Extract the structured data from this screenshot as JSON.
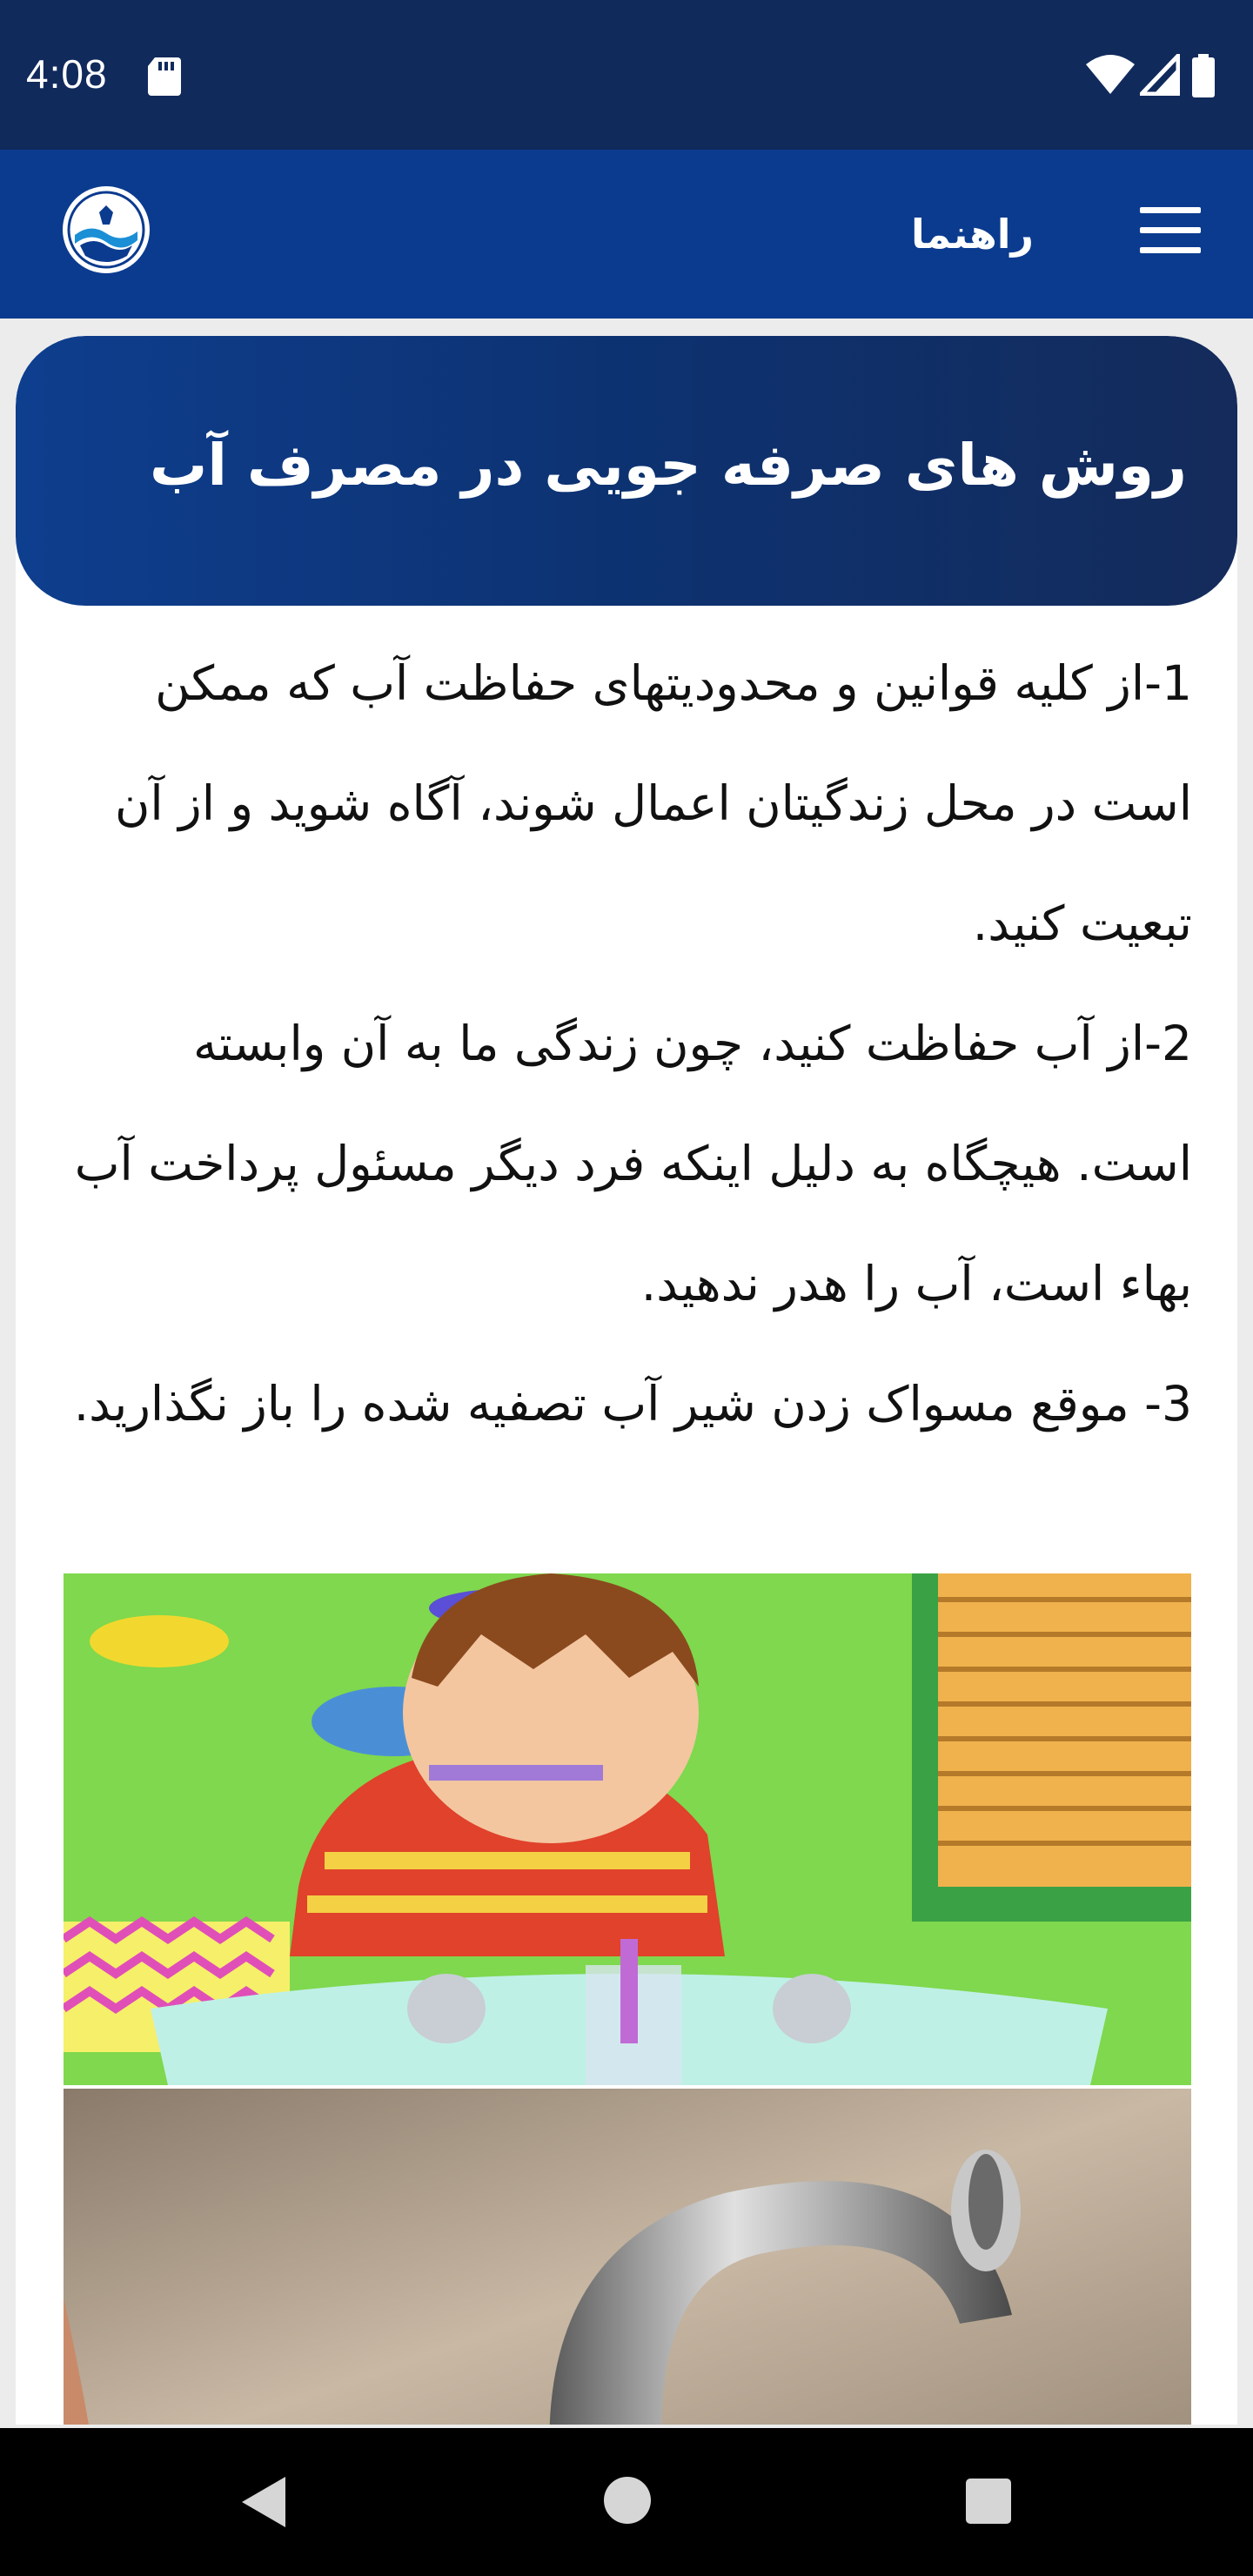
{
  "status_bar": {
    "time": "4:08"
  },
  "app_bar": {
    "title": "راهنما"
  },
  "article": {
    "title": "روش های صرفه جویی در مصرف آب",
    "paragraphs": [
      "1-از کلیه قوانین و محدودیتهای حفاظت آب که ممکن است در محل زندگیتان اعمال شوند، آگاه شوید و از آن تبعیت کنید.",
      "2-از آب حفاظت کنید، چون زندگی ما به آن وابسته است. هیچگاه به دلیل اینکه فرد دیگر مسئول پرداخت آب بهاء است، آب را هدر ندهید.",
      "3- موقع مسواک زدن شیر آب تصفیه شده را باز نگذارید."
    ]
  },
  "colors": {
    "status_bar": "#112a5c",
    "app_bar": "#0b3b8f",
    "card_header": "#0d3271"
  }
}
